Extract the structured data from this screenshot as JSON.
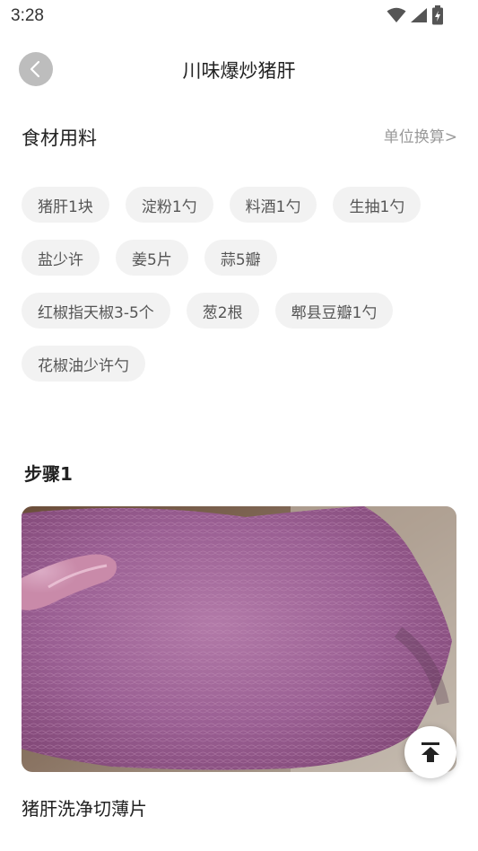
{
  "status_bar": {
    "time": "3:28"
  },
  "header": {
    "title": "川味爆炒猪肝"
  },
  "ingredients": {
    "section_title": "食材用料",
    "unit_link": "单位换算>",
    "rows": [
      [
        "猪肝1块",
        "淀粉1勺",
        "料酒1勺",
        "生抽1勺"
      ],
      [
        "盐少许",
        "姜5片",
        "蒜5瓣"
      ],
      [
        "红椒指天椒3-5个",
        "葱2根",
        "郫县豆瓣1勺"
      ],
      [
        "花椒油少许勺"
      ]
    ]
  },
  "step": {
    "title": "步骤1",
    "description": "猪肝洗净切薄片"
  },
  "icons": {
    "back": "chevron-left-icon",
    "scroll_top": "arrow-up-to-top-icon",
    "wifi": "wifi-icon",
    "signal": "signal-icon",
    "battery": "battery-charging-icon"
  }
}
